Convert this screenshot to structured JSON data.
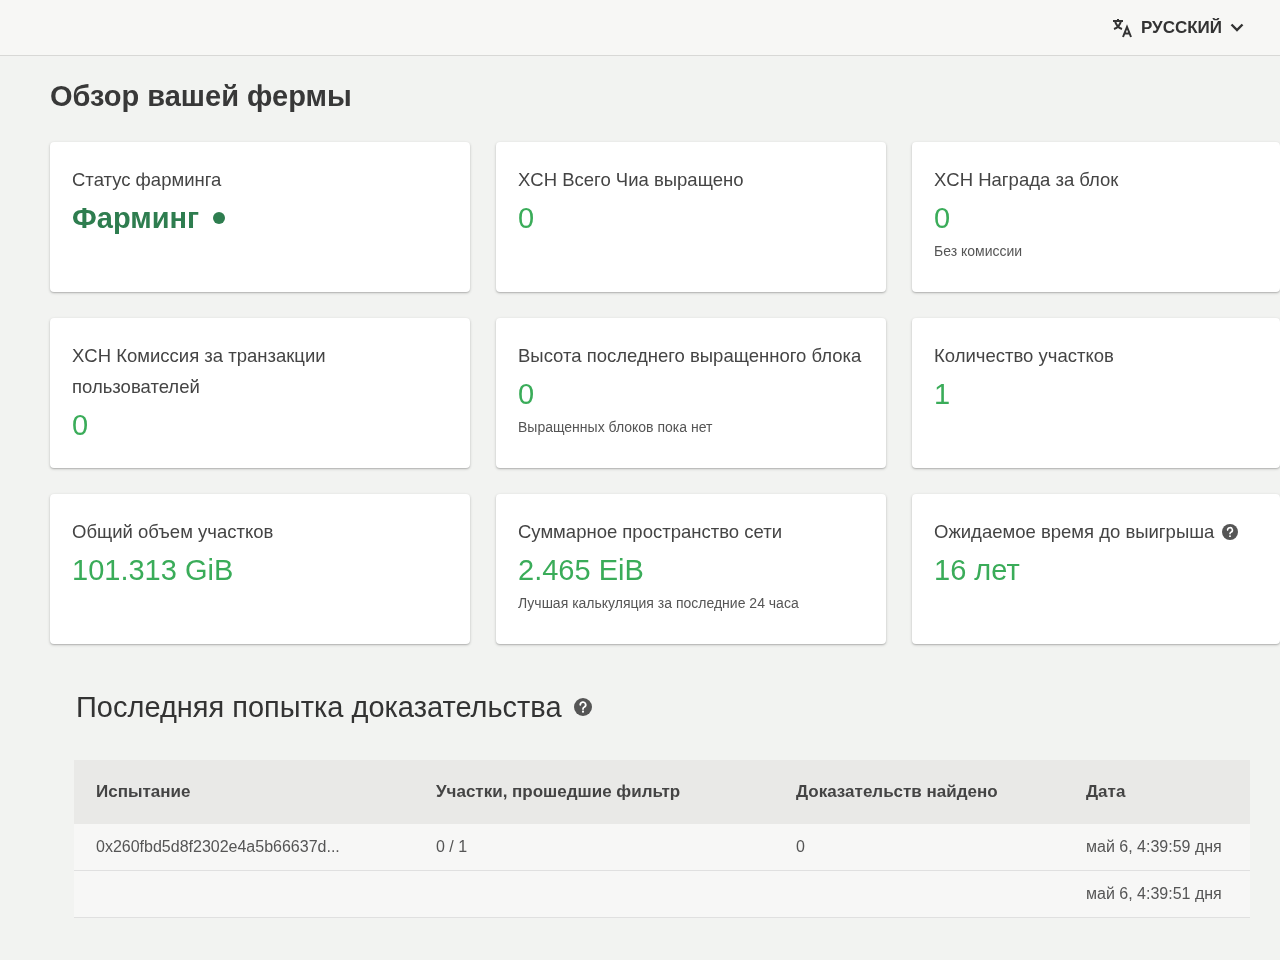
{
  "top_bar": {
    "language": "РУССКИЙ"
  },
  "title": "Обзор вашей фермы",
  "cards": [
    {
      "kind": "status",
      "label": "Статус фарминга",
      "value": "Фарминг",
      "color": "#2e7d4f"
    },
    {
      "kind": "value",
      "label": "XCH Всего Чиа выращено",
      "value": "0"
    },
    {
      "kind": "value",
      "label": "XCH Награда за блок",
      "value": "0",
      "note": "Без комиссии"
    },
    {
      "kind": "value",
      "label": "XCH Комиссия за транзакции пользователей",
      "value": "0"
    },
    {
      "kind": "value",
      "label": "Высота последнего выращенного блока",
      "value": "0",
      "note": "Выращенных блоков пока нет"
    },
    {
      "kind": "value",
      "label": "Количество участков",
      "value": "1"
    },
    {
      "kind": "value",
      "label": "Общий объем участков",
      "value": "101.313 GiB"
    },
    {
      "kind": "value",
      "label": "Суммарное пространство сети",
      "value": "2.465 EiB",
      "note": "Лучшая калькуляция за последние 24 часа"
    },
    {
      "kind": "value",
      "label": "Ожидаемое время до выигрыша",
      "value": "16 лет",
      "help": true
    }
  ],
  "proofs": {
    "title": "Последняя попытка доказательства",
    "help": true,
    "table": {
      "columns": [
        "Испытание",
        "Участки, прошедшие фильтр",
        "Доказательств найдено",
        "Дата"
      ],
      "rows": [
        {
          "challenge": "0x260fbd5d8f2302e4a5b66637d...",
          "plots_passed": "0 / 1",
          "proofs_found": "0",
          "date": "май 6, 4:39:59 дня"
        },
        {
          "date": "май 6, 4:39:51 дня"
        }
      ]
    }
  }
}
